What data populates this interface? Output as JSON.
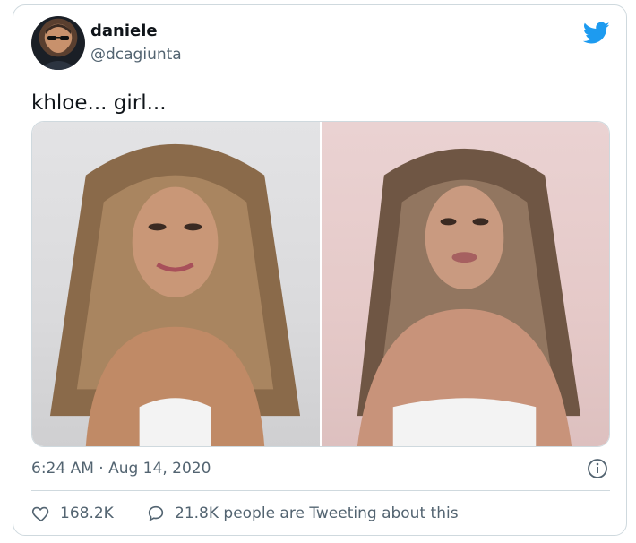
{
  "tweet": {
    "display_name": "daniele",
    "handle": "@dcagiunta",
    "text": "khloe... girl...",
    "timestamp": "6:24 AM · Aug 14, 2020",
    "likes": "168.2K",
    "replies_text": "21.8K people are Tweeting about this"
  },
  "icons": {
    "brand": "twitter-bird-icon",
    "info": "info-icon",
    "like": "heart-icon",
    "reply": "speech-bubble-icon"
  },
  "colors": {
    "twitter_blue": "#1d9bf0",
    "text_primary": "#0f1419",
    "text_secondary": "#536471",
    "border": "#cfd9de"
  }
}
